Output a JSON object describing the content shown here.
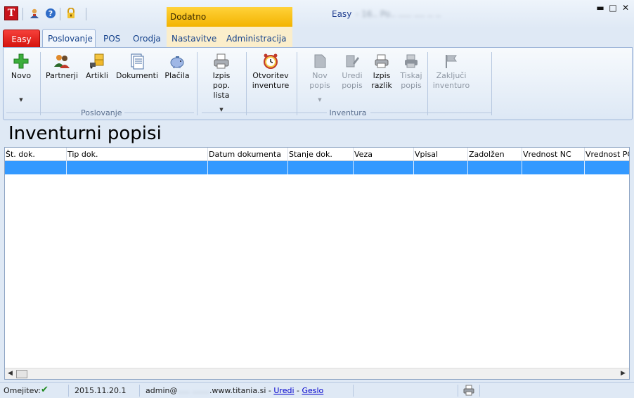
{
  "app": {
    "logo_letter": "T",
    "title_app": "Easy",
    "title_company": " - 16.. Po..  .....  ....  ..  ..",
    "contextual_tab_header": "Dodatno"
  },
  "window_controls": {
    "minimize": "▬",
    "maximize": "□",
    "close": "✕"
  },
  "tabs": [
    {
      "label": "Easy"
    },
    {
      "label": "Poslovanje"
    },
    {
      "label": "POS"
    },
    {
      "label": "Orodja"
    },
    {
      "label": "Nastavitve"
    },
    {
      "label": "Administracija"
    }
  ],
  "ribbon": {
    "groups": {
      "poslovanje": "Poslovanje",
      "inventura": "Inventura"
    },
    "buttons": {
      "novo": "Novo",
      "partnerji": "Partnerji",
      "artikli": "Artikli",
      "dokumenti": "Dokumenti",
      "placila": "Plačila",
      "izpis_pop_lista_1": "Izpis",
      "izpis_pop_lista_2": "pop. lista",
      "otvoritev_1": "Otvoritev",
      "otvoritev_2": "inventure",
      "nov_popis_1": "Nov",
      "nov_popis_2": "popis",
      "uredi_popis_1": "Uredi",
      "uredi_popis_2": "popis",
      "izpis_razlik_1": "Izpis",
      "izpis_razlik_2": "razlik",
      "tiskaj_popis_1": "Tiskaj",
      "tiskaj_popis_2": "popis",
      "zakljuci_1": "Zaključi",
      "zakljuci_2": "inventuro"
    }
  },
  "page_title": "Inventurni popisi",
  "grid": {
    "columns": [
      "Št. dok.",
      "Tip dok.",
      "Datum dokumenta",
      "Stanje dok.",
      "Veza",
      "Vpisal",
      "Zadolžen",
      "Vrednost NC",
      "Vrednost PC"
    ],
    "selected_row_color": "#3399ff"
  },
  "statusbar": {
    "omejitev_label": "Omejitev:",
    "check": "✔",
    "date": "2015.11.20.1",
    "user_prefix": "admin@",
    "user_masked": ".....  .......",
    "user_domain": ".www.titania.si - ",
    "uredi": "Uredi",
    "dash": " - ",
    "geslo": "Geslo"
  },
  "colors": {
    "accent_blue": "#15428b",
    "easy_red": "#d3110c",
    "contextual_orange": "#f3b300",
    "selection_blue": "#3399ff"
  }
}
